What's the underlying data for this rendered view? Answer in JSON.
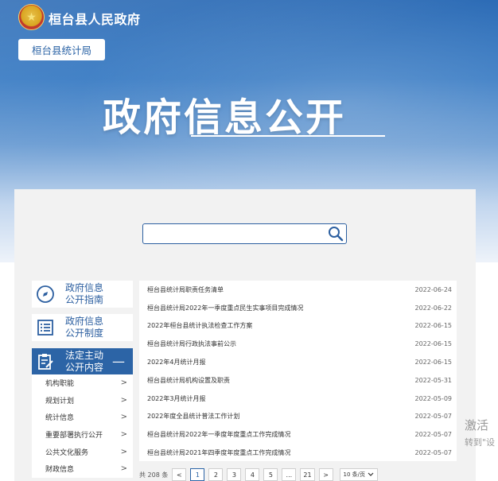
{
  "header": {
    "gov_name": "桓台县人民政府",
    "bureau_tab": "桓台县统计局",
    "big_title": "政府信息公开"
  },
  "search": {
    "placeholder": "",
    "icon": "search-icon"
  },
  "sidebar": {
    "cards": [
      {
        "label_line1": "政府信息",
        "label_line2": "公开指南",
        "icon": "compass-icon"
      },
      {
        "label_line1": "政府信息",
        "label_line2": "公开制度",
        "icon": "list-document-icon"
      }
    ],
    "active": {
      "label_line1": "法定主动",
      "label_line2": "公开内容",
      "icon": "clipboard-edit-icon",
      "toggle": "—"
    },
    "sub_items": [
      {
        "label": "机构职能"
      },
      {
        "label": "规划计划"
      },
      {
        "label": "统计信息"
      },
      {
        "label": "重要部署执行公开"
      },
      {
        "label": "公共文化服务"
      },
      {
        "label": "财政信息"
      }
    ]
  },
  "list": [
    {
      "title": "桓台县统计局职责任务清单",
      "date": "2022-06-24"
    },
    {
      "title": "桓台县统计局2022年一季度重点民生实事项目完成情况",
      "date": "2022-06-22"
    },
    {
      "title": "2022年桓台县统计执法检查工作方案",
      "date": "2022-06-15"
    },
    {
      "title": "桓台县统计局行政执法事前公示",
      "date": "2022-06-15"
    },
    {
      "title": "2022年4月统计月报",
      "date": "2022-06-15"
    },
    {
      "title": "桓台县统计局机构设置及职责",
      "date": "2022-05-31"
    },
    {
      "title": "2022年3月统计月报",
      "date": "2022-05-09"
    },
    {
      "title": "2022年度全县统计普法工作计划",
      "date": "2022-05-07"
    },
    {
      "title": "桓台县统计局2022年一季度年度重点工作完成情况",
      "date": "2022-05-07"
    },
    {
      "title": "桓台县统计局2021年四季度年度重点工作完成情况",
      "date": "2022-05-07"
    }
  ],
  "pager": {
    "total": "共 208 条",
    "prev": "<",
    "pages": [
      "1",
      "2",
      "3",
      "4",
      "5",
      "...",
      "21"
    ],
    "current": "1",
    "next": ">",
    "page_size": "10 条/页"
  },
  "watermark": {
    "line1": "激活",
    "line2": "转到\"设"
  }
}
